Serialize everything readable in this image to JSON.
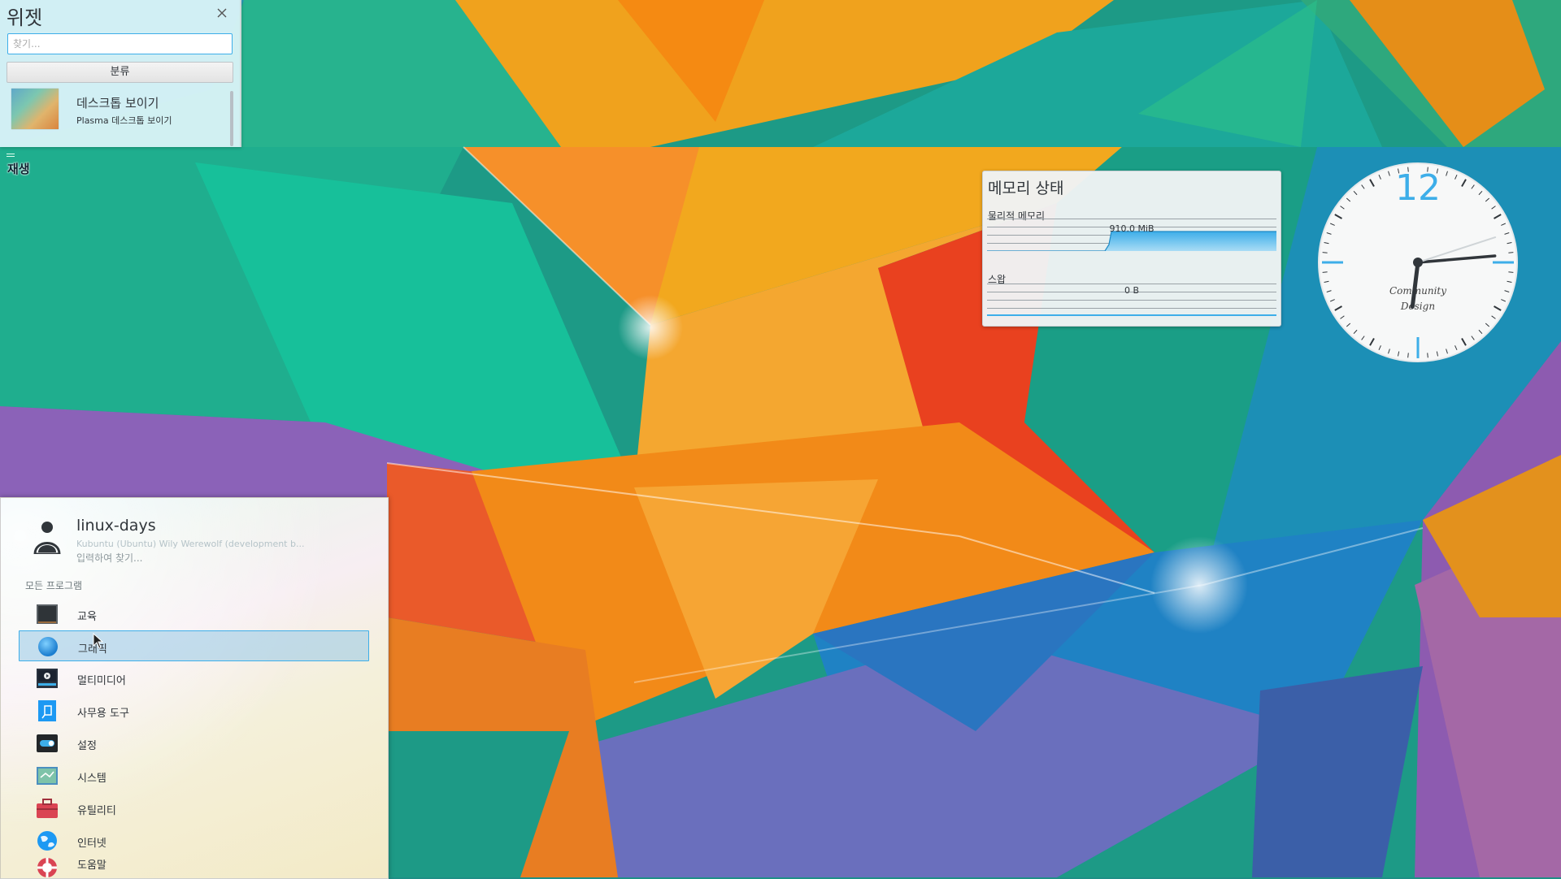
{
  "widget_explorer": {
    "title": "위젯",
    "search_placeholder": "찾기...",
    "categories_label": "분류",
    "items": [
      {
        "title": "데스크톱 보이기",
        "subtitle": "Plasma 데스크톱 보이기"
      }
    ]
  },
  "desktop_toolbox": {
    "label": "재생"
  },
  "memory_widget": {
    "title": "메모리 상태",
    "physical_label": "물리적 메모리",
    "physical_value": "910.0 MiB",
    "swap_label": "스왑",
    "swap_value": "0 B"
  },
  "clock": {
    "numeral": "12",
    "brand_line1": "Community",
    "brand_line2": "Design",
    "time": {
      "hour": 6,
      "minute": 14,
      "second": 12
    }
  },
  "launcher": {
    "user_name": "linux-days",
    "user_description": "Kubuntu (Ubuntu) Wily Werewolf (development b...",
    "search_hint": "입력하여 찾기...",
    "section_title": "모든 프로그램",
    "items": [
      {
        "label": "교육",
        "icon": "education-icon",
        "selected": false
      },
      {
        "label": "그래픽",
        "icon": "graphics-icon",
        "selected": true
      },
      {
        "label": "멀티미디어",
        "icon": "multimedia-icon",
        "selected": false
      },
      {
        "label": "사무용 도구",
        "icon": "office-icon",
        "selected": false
      },
      {
        "label": "설정",
        "icon": "settings-icon",
        "selected": false
      },
      {
        "label": "시스템",
        "icon": "system-icon",
        "selected": false
      },
      {
        "label": "유틸리티",
        "icon": "utilities-icon",
        "selected": false
      },
      {
        "label": "인터넷",
        "icon": "internet-icon",
        "selected": false
      },
      {
        "label": "도움말",
        "icon": "help-icon",
        "selected": false
      }
    ]
  },
  "colors": {
    "accent": "#3daee9",
    "text": "#31363b"
  }
}
